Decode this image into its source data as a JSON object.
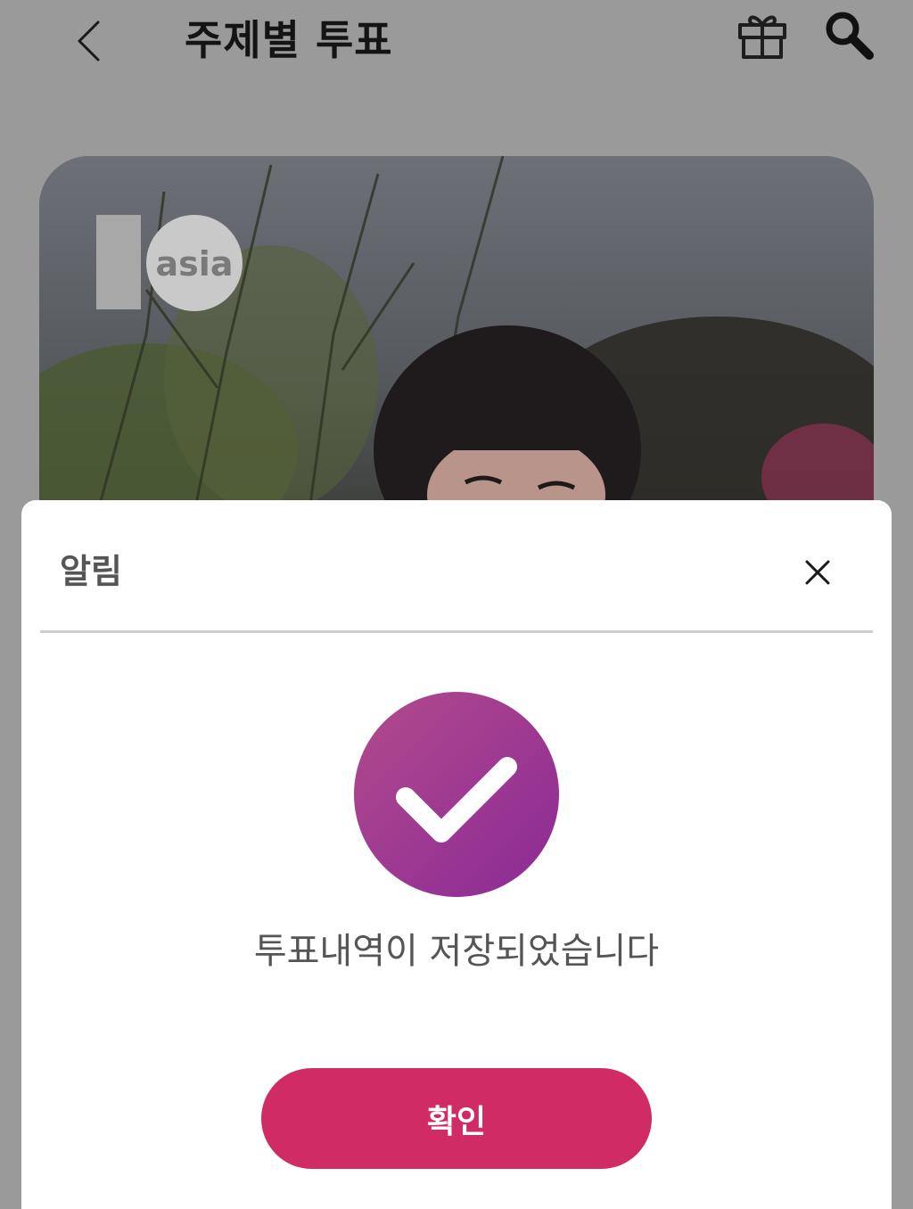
{
  "header": {
    "title": "주제별 투표",
    "back_icon": "chevron-left-icon",
    "gift_icon": "gift-icon",
    "search_icon": "search-icon"
  },
  "hero": {
    "logo": {
      "number": "1",
      "text": "asia"
    }
  },
  "dialog": {
    "title": "알림",
    "close_icon": "close-icon",
    "status_icon": "check-circle-icon",
    "message": "투표내역이 저장되었습니다",
    "confirm_label": "확인"
  },
  "colors": {
    "overlay": "#9a9a9a",
    "accent_button": "#d12b65",
    "check_gradient_start": "#b34a8c",
    "check_gradient_end": "#8a2a96",
    "text_muted": "#555555"
  }
}
